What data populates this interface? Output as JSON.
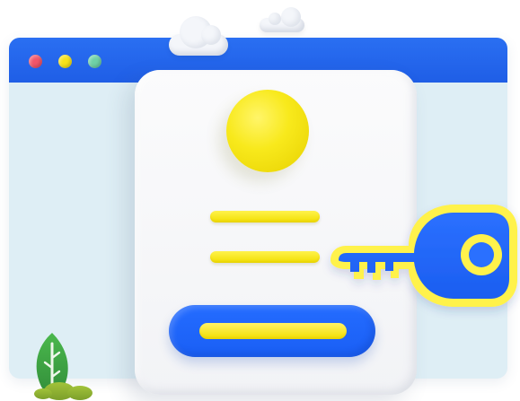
{
  "colors": {
    "browser_background": "#deeef5",
    "browser_bar": "#1f5ee6",
    "card_background": "#f6f7f9",
    "accent_blue": "#1f5ff2",
    "accent_yellow": "#f7e21a",
    "window_dot_red": "#f25569",
    "window_dot_yellow": "#f7e21a",
    "window_dot_green": "#6ed1a6",
    "plant_green": "#3fae47",
    "bush_green": "#8db233"
  },
  "icons": {
    "window_dots": [
      "window-close-dot-icon",
      "window-minimize-dot-icon",
      "window-maximize-dot-icon"
    ],
    "avatar": "user-avatar-icon",
    "key": "key-icon",
    "clouds": [
      "cloud-icon",
      "cloud-icon"
    ],
    "plant": "leaf-icon"
  }
}
